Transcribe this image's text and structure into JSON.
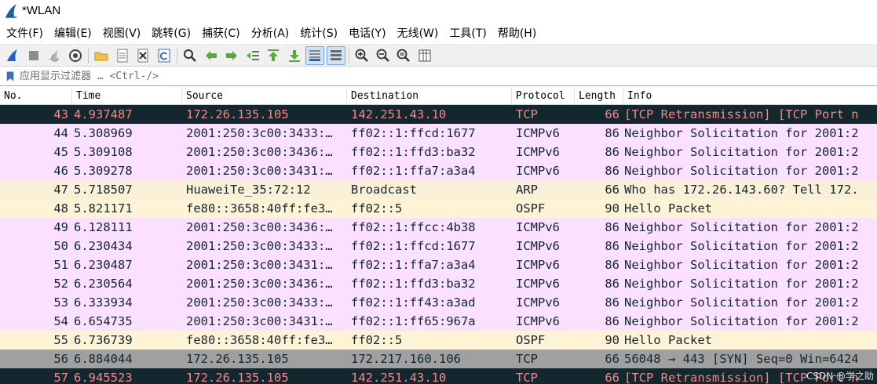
{
  "window": {
    "title": "*WLAN"
  },
  "menu": [
    "文件(F)",
    "编辑(E)",
    "视图(V)",
    "跳转(G)",
    "捕获(C)",
    "分析(A)",
    "统计(S)",
    "电话(Y)",
    "无线(W)",
    "工具(T)",
    "帮助(H)"
  ],
  "filter": {
    "placeholder": "应用显示过滤器 … <Ctrl-/>",
    "value": ""
  },
  "columns": {
    "no": "No.",
    "time": "Time",
    "source": "Source",
    "destination": "Destination",
    "protocol": "Protocol",
    "length": "Length",
    "info": "Info"
  },
  "packets": [
    {
      "no": "43",
      "time": "4.937487",
      "source": "172.26.135.105",
      "destination": "142.251.43.10",
      "protocol": "TCP",
      "length": "66",
      "info": "[TCP Retransmission] [TCP Port n",
      "style": "tcp-bad"
    },
    {
      "no": "44",
      "time": "5.308969",
      "source": "2001:250:3c00:3433:…",
      "destination": "ff02::1:ffcd:1677",
      "protocol": "ICMPv6",
      "length": "86",
      "info": "Neighbor Solicitation for 2001:2",
      "style": "icmpv6"
    },
    {
      "no": "45",
      "time": "5.309108",
      "source": "2001:250:3c00:3436:…",
      "destination": "ff02::1:ffd3:ba32",
      "protocol": "ICMPv6",
      "length": "86",
      "info": "Neighbor Solicitation for 2001:2",
      "style": "icmpv6"
    },
    {
      "no": "46",
      "time": "5.309278",
      "source": "2001:250:3c00:3431:…",
      "destination": "ff02::1:ffa7:a3a4",
      "protocol": "ICMPv6",
      "length": "86",
      "info": "Neighbor Solicitation for 2001:2",
      "style": "icmpv6"
    },
    {
      "no": "47",
      "time": "5.718507",
      "source": "HuaweiTe_35:72:12",
      "destination": "Broadcast",
      "protocol": "ARP",
      "length": "66",
      "info": "Who has 172.26.143.60? Tell 172.",
      "style": "arp"
    },
    {
      "no": "48",
      "time": "5.821171",
      "source": "fe80::3658:40ff:fe3…",
      "destination": "ff02::5",
      "protocol": "OSPF",
      "length": "90",
      "info": "Hello Packet",
      "style": "ospf"
    },
    {
      "no": "49",
      "time": "6.128111",
      "source": "2001:250:3c00:3436:…",
      "destination": "ff02::1:ffcc:4b38",
      "protocol": "ICMPv6",
      "length": "86",
      "info": "Neighbor Solicitation for 2001:2",
      "style": "icmpv6"
    },
    {
      "no": "50",
      "time": "6.230434",
      "source": "2001:250:3c00:3433:…",
      "destination": "ff02::1:ffcd:1677",
      "protocol": "ICMPv6",
      "length": "86",
      "info": "Neighbor Solicitation for 2001:2",
      "style": "icmpv6"
    },
    {
      "no": "51",
      "time": "6.230487",
      "source": "2001:250:3c00:3431:…",
      "destination": "ff02::1:ffa7:a3a4",
      "protocol": "ICMPv6",
      "length": "86",
      "info": "Neighbor Solicitation for 2001:2",
      "style": "icmpv6"
    },
    {
      "no": "52",
      "time": "6.230564",
      "source": "2001:250:3c00:3436:…",
      "destination": "ff02::1:ffd3:ba32",
      "protocol": "ICMPv6",
      "length": "86",
      "info": "Neighbor Solicitation for 2001:2",
      "style": "icmpv6"
    },
    {
      "no": "53",
      "time": "6.333934",
      "source": "2001:250:3c00:3433:…",
      "destination": "ff02::1:ff43:a3ad",
      "protocol": "ICMPv6",
      "length": "86",
      "info": "Neighbor Solicitation for 2001:2",
      "style": "icmpv6"
    },
    {
      "no": "54",
      "time": "6.654735",
      "source": "2001:250:3c00:3431:…",
      "destination": "ff02::1:ff65:967a",
      "protocol": "ICMPv6",
      "length": "86",
      "info": "Neighbor Solicitation for 2001:2",
      "style": "icmpv6"
    },
    {
      "no": "55",
      "time": "6.736739",
      "source": "fe80::3658:40ff:fe3…",
      "destination": "ff02::5",
      "protocol": "OSPF",
      "length": "90",
      "info": "Hello Packet",
      "style": "ospf"
    },
    {
      "no": "56",
      "time": "6.884044",
      "source": "172.26.135.105",
      "destination": "172.217.160.106",
      "protocol": "TCP",
      "length": "66",
      "info": "56048 → 443 [SYN] Seq=0 Win=6424",
      "style": "tcp-syn"
    },
    {
      "no": "57",
      "time": "6.945523",
      "source": "172.26.135.105",
      "destination": "142.251.43.10",
      "protocol": "TCP",
      "length": "66",
      "info": "[TCP Retransmission] [TCP Port n",
      "style": "tcp-bad"
    }
  ],
  "watermark": "CSDN @学之助",
  "colors": {
    "tcp_bad_bg": "#12272e",
    "tcp_bad_fg": "#f78787",
    "icmpv6_bg": "#fce0ff",
    "arp_bg": "#faf0d7",
    "ospf_bg": "#fff3d6",
    "syn_bg": "#a0a0a0"
  },
  "toolbar_icons": [
    "start-capture-icon",
    "stop-capture-icon",
    "restart-capture-icon",
    "capture-options-icon",
    "open-file-icon",
    "save-file-icon",
    "close-file-icon",
    "reload-icon",
    "find-packet-icon",
    "go-back-icon",
    "go-forward-icon",
    "go-to-packet-icon",
    "go-first-icon",
    "go-last-icon",
    "auto-scroll-icon",
    "colorize-icon",
    "zoom-in-icon",
    "zoom-out-icon",
    "zoom-normal-icon",
    "resize-columns-icon"
  ]
}
